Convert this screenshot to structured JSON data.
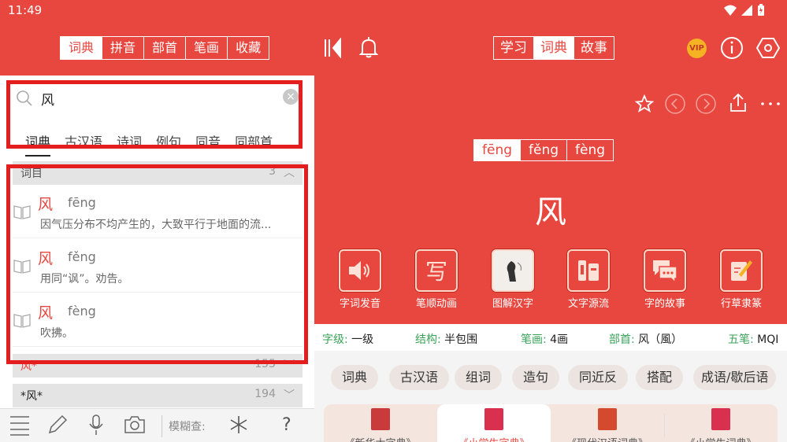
{
  "status": {
    "time": "11:49"
  },
  "left": {
    "tabs": [
      "词典",
      "拼音",
      "部首",
      "笔画",
      "收藏"
    ],
    "search": {
      "query": "风"
    },
    "subtabs": [
      "词典",
      "古汉语",
      "诗词",
      "例句",
      "同音",
      "同部首"
    ],
    "section": {
      "label": "词目",
      "count": "3"
    },
    "results": [
      {
        "char": "风",
        "pinyin": "fēng",
        "definition": "因气压分布不均产生的，大致平行于地面的流..."
      },
      {
        "char": "风",
        "pinyin": "fěng",
        "definition": "用同“讽”。劝告。"
      },
      {
        "char": "风",
        "pinyin": "fèng",
        "definition": "吹拂。"
      }
    ],
    "more": [
      {
        "label": "风*",
        "count": "155"
      },
      {
        "label": "*风*",
        "count": "194"
      }
    ],
    "bottom": {
      "fuzzy_label": "模糊查:",
      "help": "?"
    }
  },
  "right": {
    "tabs": [
      "学习",
      "词典",
      "故事"
    ],
    "vip": "VIP",
    "pinyins": [
      "fēng",
      "fěng",
      "fèng"
    ],
    "character": "风",
    "features": [
      {
        "label": "字词发音",
        "icon": "speaker-icon"
      },
      {
        "label": "笔顺动画",
        "icon": "stroke-order-icon"
      },
      {
        "label": "图解汉字",
        "icon": "illustration-icon"
      },
      {
        "label": "文字源流",
        "icon": "origin-icon"
      },
      {
        "label": "字的故事",
        "icon": "story-icon"
      },
      {
        "label": "行草隶篆",
        "icon": "calligraphy-icon"
      }
    ],
    "feature_glyph": "写",
    "info": {
      "level_k": "字级:",
      "level_v": "一级",
      "struct_k": "结构:",
      "struct_v": "半包围",
      "strokes_k": "笔画:",
      "strokes_v": "4画",
      "radical_k": "部首:",
      "radical_v": "风（風）",
      "wubi_k": "五笔:",
      "wubi_v": "MQI"
    },
    "chips": [
      "词典",
      "古汉语",
      "组词",
      "造句",
      "同近反",
      "搭配",
      "成语/歇后语"
    ],
    "dictionaries": [
      "《新华大字典》",
      "《小学生字典》",
      "《现代汉语词典》",
      "《小学生词典》"
    ],
    "colors": {
      "brand": "#e8473f",
      "highlight_box": "#e41e1e",
      "label_green": "#3aa35a"
    }
  }
}
